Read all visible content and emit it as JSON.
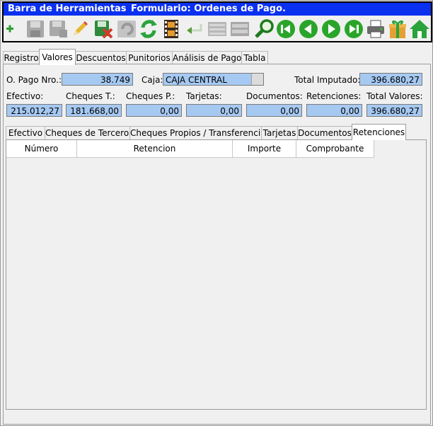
{
  "toolbar": {
    "title": "Barra de Herramientas",
    "form_title": "Formulario: Ordenes de Pago.",
    "icons": [
      "add-icon",
      "save-icon",
      "save-as-icon",
      "edit-icon",
      "delete-icon",
      "undo-icon",
      "refresh-icon",
      "film-icon",
      "return-icon",
      "list-icon",
      "list2-icon",
      "search-icon",
      "first-icon",
      "prev-icon",
      "next-icon",
      "last-icon",
      "print-icon",
      "gift-icon",
      "home-icon"
    ]
  },
  "tabs": [
    "Registro",
    "Valores",
    "Descuentos",
    "Punitorios",
    "Análisis de Pago",
    "Tabla"
  ],
  "active_tab": "Valores",
  "header": {
    "opago_label": "O. Pago Nro.:",
    "opago_value": "38.749",
    "caja_label": "Caja:",
    "caja_value": "CAJA CENTRAL",
    "total_imputado_label": "Total Imputado:",
    "total_imputado_value": "396.680,27"
  },
  "totals": {
    "efectivo_label": "Efectivo:",
    "efectivo_value": "215.012,27",
    "cheques_t_label": "Cheques T.:",
    "cheques_t_value": "181.668,00",
    "cheques_p_label": "Cheques P.:",
    "cheques_p_value": "0,00",
    "tarjetas_label": "Tarjetas:",
    "tarjetas_value": "0,00",
    "documentos_label": "Documentos:",
    "documentos_value": "0,00",
    "retenciones_label": "Retenciones:",
    "retenciones_value": "0,00",
    "total_valores_label": "Total Valores:",
    "total_valores_value": "396.680,27"
  },
  "subtabs": [
    "Efectivo",
    "Cheques de Terceros",
    "Cheques Propios / Transferencias",
    "Tarjetas",
    "Documentos",
    "Retenciones"
  ],
  "active_subtab": "Retenciones",
  "grid": {
    "columns": [
      "Número",
      "Retencion",
      "Importe",
      "Comprobante"
    ]
  },
  "colors": {
    "title_bar": "#0a30f0",
    "field_bg": "#a6c9f2",
    "panel_bg": "#f0f0f0"
  }
}
